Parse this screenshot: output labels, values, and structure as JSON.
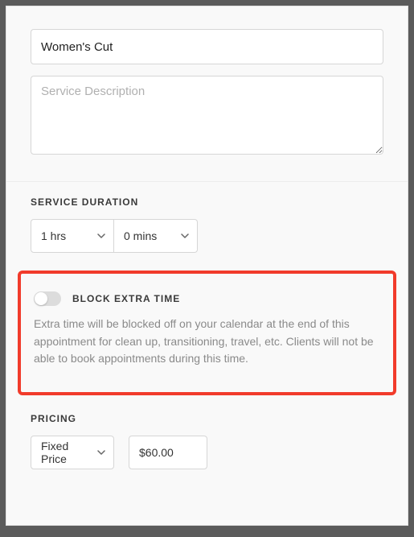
{
  "service": {
    "name": "Women's Cut",
    "description_placeholder": "Service Description",
    "description_value": ""
  },
  "duration": {
    "label": "SERVICE DURATION",
    "hours": "1 hrs",
    "minutes": "0 mins"
  },
  "block_extra_time": {
    "label": "BLOCK EXTRA TIME",
    "help": "Extra time will be blocked off on your calendar at the end of this appointment for clean up, transitioning, travel, etc. Clients will not be able to book appointments during this time.",
    "enabled": false
  },
  "pricing": {
    "label": "PRICING",
    "type": "Fixed Price",
    "amount": "$60.00"
  }
}
